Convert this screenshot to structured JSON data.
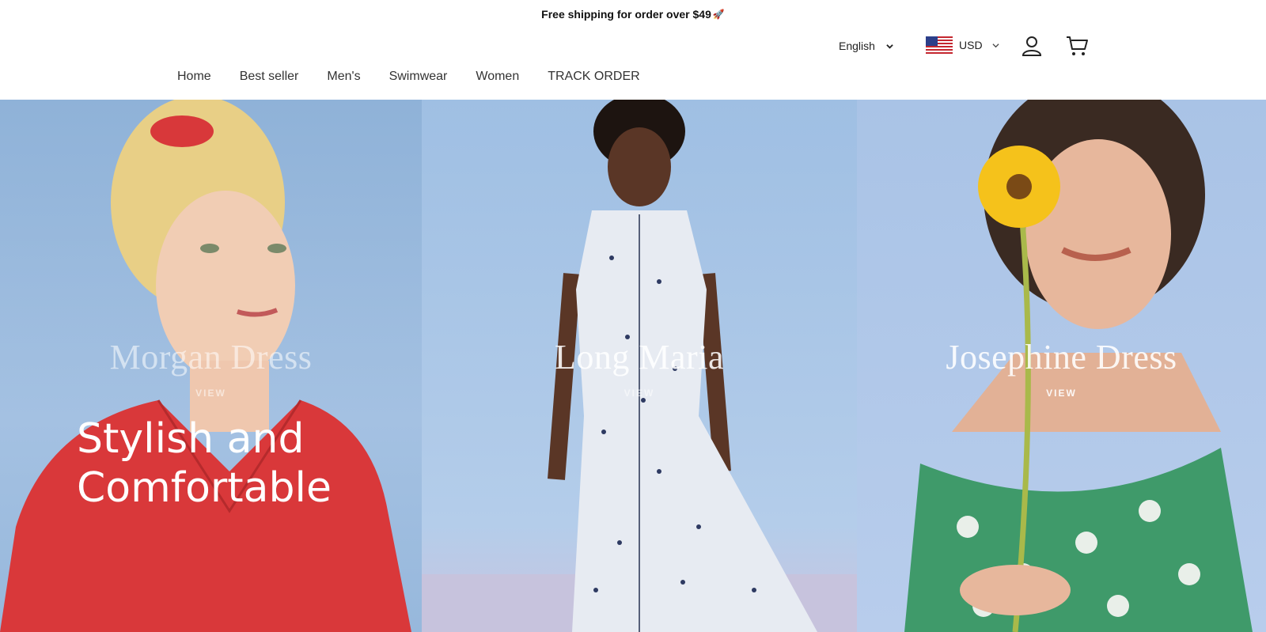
{
  "announcement": {
    "text": "Free shipping for order over $49",
    "icon": "rocket-icon"
  },
  "header": {
    "language": "English",
    "currency": "USD",
    "icons": [
      "us-flag-icon",
      "chevron-down-icon",
      "account-icon",
      "cart-icon"
    ]
  },
  "nav": {
    "items": [
      {
        "label": "Home"
      },
      {
        "label": "Best seller"
      },
      {
        "label": "Men's"
      },
      {
        "label": "Swimwear"
      },
      {
        "label": "Women"
      },
      {
        "label": "TRACK ORDER"
      }
    ]
  },
  "hero": {
    "headline": "Stylish and Comfortable",
    "panels": [
      {
        "title": "Morgan Dress",
        "view": "VIEW"
      },
      {
        "title": "Long Maria",
        "view": "VIEW"
      },
      {
        "title": "Josephine Dress",
        "view": "VIEW"
      }
    ]
  },
  "colors": {
    "accent": "#2aa0c8",
    "hero_blue": "#a4c1e2",
    "dress_red": "#d9383a",
    "dress_green": "#3f9a6a",
    "flower_yellow": "#f5c21b"
  }
}
